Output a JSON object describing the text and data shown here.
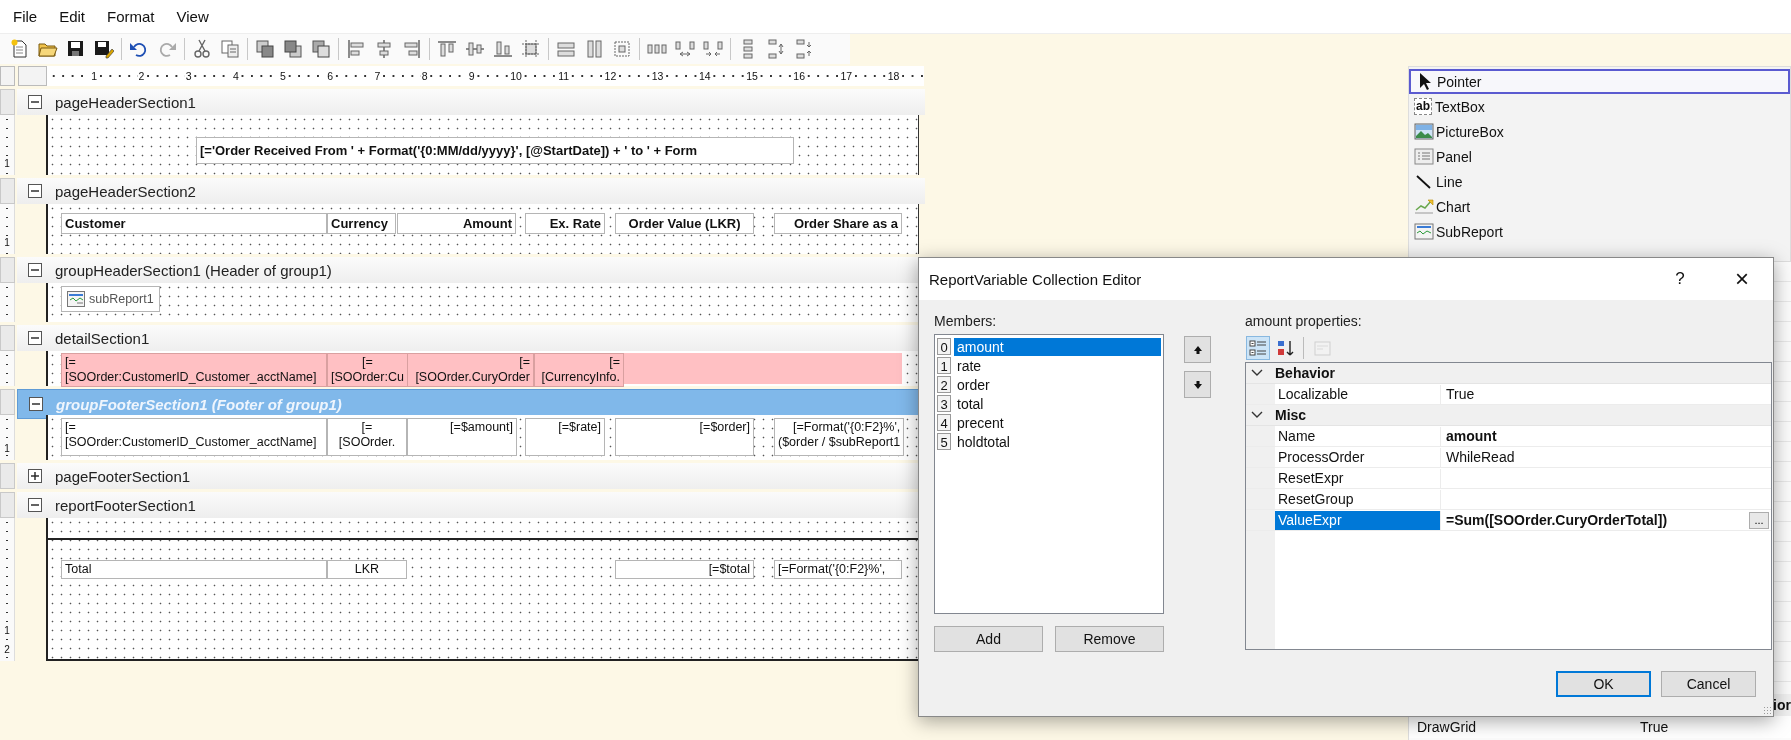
{
  "menu": [
    {
      "label": "File"
    },
    {
      "label": "Edit"
    },
    {
      "label": "Format"
    },
    {
      "label": "View"
    }
  ],
  "ruler": {
    "numbers": [
      "1",
      "2",
      "3",
      "4",
      "5",
      "6",
      "7",
      "8",
      "9",
      "10",
      "11",
      "12",
      "13",
      "14",
      "15",
      "16",
      "17",
      "18"
    ]
  },
  "sections": [
    {
      "title": "pageHeaderSection1",
      "expanded": true,
      "selected": false,
      "highlighted": false,
      "ruler_marks": [
        "1"
      ],
      "fields": [
        {
          "kind": "text",
          "bold": true,
          "lines": [
            "[='Order Received From ' + Format('{0:MM/dd/yyyy}', [@StartDate]) + ' to ' + Form"
          ]
        }
      ]
    },
    {
      "title": "pageHeaderSection2",
      "expanded": true,
      "selected": false,
      "highlighted": false,
      "ruler_marks": [
        "1"
      ],
      "fields": [
        {
          "kind": "text",
          "bold": true,
          "lines": [
            "Customer"
          ]
        },
        {
          "kind": "text",
          "bold": true,
          "lines": [
            "Currency"
          ]
        },
        {
          "kind": "text",
          "bold": true,
          "lines": [
            "Amount"
          ]
        },
        {
          "kind": "text",
          "bold": true,
          "lines": [
            "Ex. Rate"
          ]
        },
        {
          "kind": "text",
          "bold": true,
          "lines": [
            "Order Value (LKR)"
          ]
        },
        {
          "kind": "text",
          "bold": true,
          "lines": [
            "Order Share as a"
          ]
        }
      ]
    },
    {
      "title": "groupHeaderSection1 (Header of group1)",
      "expanded": true,
      "selected": false,
      "highlighted": false,
      "fields": [
        {
          "kind": "subreport",
          "lines": [
            "subReport1"
          ]
        }
      ]
    },
    {
      "title": "detailSection1",
      "expanded": true,
      "selected": false,
      "highlighted": true,
      "fields": [
        {
          "kind": "text",
          "bold": false,
          "lines": [
            "[=",
            "[SOOrder:CustomerID_Customer_acctName]"
          ]
        },
        {
          "kind": "text",
          "bold": false,
          "lines": [
            "[=",
            "[SOOrder:Cu"
          ]
        },
        {
          "kind": "text",
          "bold": false,
          "lines": [
            "[=",
            "[SOOrder.CuryOrder"
          ]
        },
        {
          "kind": "text",
          "bold": false,
          "lines": [
            "[=",
            "[CurrencyInfo."
          ]
        }
      ]
    },
    {
      "title": "groupFooterSection1 (Footer of group1)",
      "expanded": true,
      "selected": true,
      "highlighted": false,
      "ruler_marks": [
        "1"
      ],
      "fields": [
        {
          "kind": "text",
          "bold": false,
          "lines": [
            "[=",
            "[SOOrder:CustomerID_Customer_acctName]"
          ]
        },
        {
          "kind": "text",
          "bold": false,
          "lines": [
            "[=",
            "[SOOrder."
          ]
        },
        {
          "kind": "text",
          "bold": false,
          "lines": [
            "[=$amount]"
          ]
        },
        {
          "kind": "text",
          "bold": false,
          "lines": [
            "[=$rate]"
          ]
        },
        {
          "kind": "text",
          "bold": false,
          "lines": [
            "[=$order]"
          ]
        },
        {
          "kind": "text",
          "bold": false,
          "lines": [
            "[=Format('{0:F2}%',",
            "($order / $subReport1"
          ]
        }
      ]
    },
    {
      "title": "pageFooterSection1",
      "expanded": false,
      "selected": false
    },
    {
      "title": "reportFooterSection1",
      "expanded": true,
      "selected": false,
      "highlighted": false,
      "ruler_marks": [
        "1",
        "2"
      ],
      "fields": [
        {
          "kind": "line"
        },
        {
          "kind": "text",
          "bold": false,
          "lines": [
            "Total"
          ]
        },
        {
          "kind": "text",
          "bold": false,
          "lines": [
            "LKR"
          ]
        },
        {
          "kind": "text",
          "bold": false,
          "lines": [
            "[=$total"
          ]
        },
        {
          "kind": "text",
          "bold": false,
          "lines": [
            "[=Format('{0:F2}%',"
          ]
        }
      ]
    }
  ],
  "toolbox": {
    "items": [
      {
        "kind": "pointer",
        "label": "Pointer",
        "selected": true
      },
      {
        "kind": "textbox",
        "label": "TextBox",
        "icon_text": "ab",
        "selected": false
      },
      {
        "kind": "picturebox",
        "label": "PictureBox",
        "selected": false
      },
      {
        "kind": "panel",
        "label": "Panel",
        "selected": false
      },
      {
        "kind": "line",
        "label": "Line",
        "selected": false
      },
      {
        "kind": "chart",
        "label": "Chart",
        "selected": false
      },
      {
        "kind": "subreport",
        "label": "SubReport",
        "selected": false
      }
    ]
  },
  "side_properties": {
    "rows": [
      {
        "kind": "category",
        "label": "ior"
      },
      {
        "kind": "property",
        "name": "DrawGrid",
        "value": "True"
      }
    ]
  },
  "dialog": {
    "title": "ReportVariable Collection Editor",
    "help_button": "?",
    "close_button": "×",
    "members_label": "Members:",
    "members": [
      {
        "index": "0",
        "label": "amount",
        "selected": true
      },
      {
        "index": "1",
        "label": "rate",
        "selected": false
      },
      {
        "index": "2",
        "label": "order",
        "selected": false
      },
      {
        "index": "3",
        "label": "total",
        "selected": false
      },
      {
        "index": "4",
        "label": "precent",
        "selected": false
      },
      {
        "index": "5",
        "label": "holdtotal",
        "selected": false
      }
    ],
    "add_button": "Add",
    "remove_button": "Remove",
    "properties_label": "amount properties:",
    "grid_toolbar": [
      {
        "kind": "categorized",
        "selected": true,
        "disabled": false
      },
      {
        "kind": "alphabetical",
        "selected": false,
        "disabled": false
      },
      {
        "kind": "pages",
        "selected": false,
        "disabled": true
      }
    ],
    "grid": [
      {
        "kind": "category",
        "label": "Behavior",
        "expanded": true
      },
      {
        "kind": "property",
        "name": "Localizable",
        "value": "True",
        "modified": false,
        "selected": false
      },
      {
        "kind": "category",
        "label": "Misc",
        "expanded": true
      },
      {
        "kind": "property",
        "name": "Name",
        "value": "amount",
        "modified": true,
        "selected": false
      },
      {
        "kind": "property",
        "name": "ProcessOrder",
        "value": "WhileRead",
        "modified": false,
        "selected": false
      },
      {
        "kind": "property",
        "name": "ResetExpr",
        "selected": false
      },
      {
        "kind": "property",
        "name": "ResetGroup",
        "selected": false
      },
      {
        "kind": "property",
        "name": "ValueExpr",
        "value": "=Sum([SOOrder.CuryOrderTotal])",
        "modified": true,
        "selected": true,
        "button_label": "..."
      }
    ],
    "ok_button": "OK",
    "cancel_button": "Cancel"
  }
}
